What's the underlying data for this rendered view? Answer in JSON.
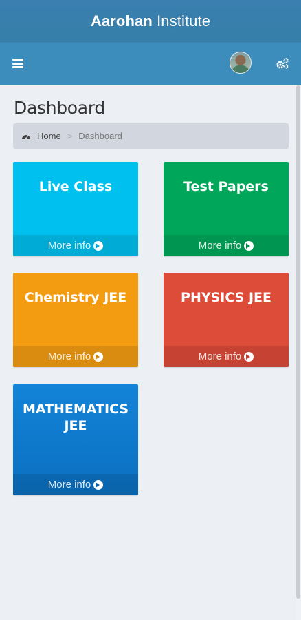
{
  "header": {
    "brand": "Aarohan",
    "title_rest": "Institute"
  },
  "navbar": {
    "menu_icon": "hamburger-icon",
    "avatar": "user-avatar",
    "settings_icon": "gears-icon"
  },
  "page": {
    "title": "Dashboard"
  },
  "breadcrumb": {
    "icon": "dashboard-icon",
    "home": "Home",
    "separator": ">",
    "current": "Dashboard"
  },
  "tiles": [
    {
      "title": "Live Class",
      "footer": "More info",
      "color": "#00c0ef"
    },
    {
      "title": "Test Papers",
      "footer": "More info",
      "color": "#00a65a"
    },
    {
      "title": "Chemistry JEE",
      "footer": "More info",
      "color": "#f39c12"
    },
    {
      "title": "PHYSICS JEE",
      "footer": "More info",
      "color": "#dd4b39"
    },
    {
      "title": "MATHEMATICS JEE",
      "footer": "More info",
      "color": "#1384d9"
    }
  ]
}
